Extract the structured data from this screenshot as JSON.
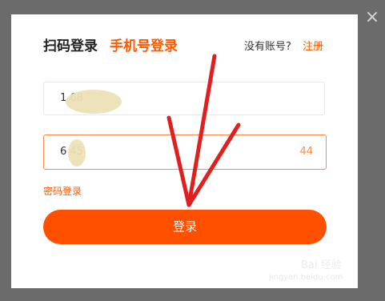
{
  "dialog": {
    "close_glyph": "×",
    "tabs": {
      "qr_login": "扫码登录",
      "phone_login": "手机号登录"
    },
    "no_account_text": "没有账号?",
    "register_link": "注册",
    "phone_input": {
      "value": "1          68"
    },
    "code_input": {
      "value": "6    45",
      "countdown": "44"
    },
    "password_login_link": "密码登录",
    "login_button": "登录"
  },
  "watermark": {
    "brand": "Bai 经验",
    "url": "jingyan.baidu.com"
  },
  "colors": {
    "accent": "#ff5000",
    "overlay": "#6b6b6b",
    "annotation": "#e0201f"
  }
}
